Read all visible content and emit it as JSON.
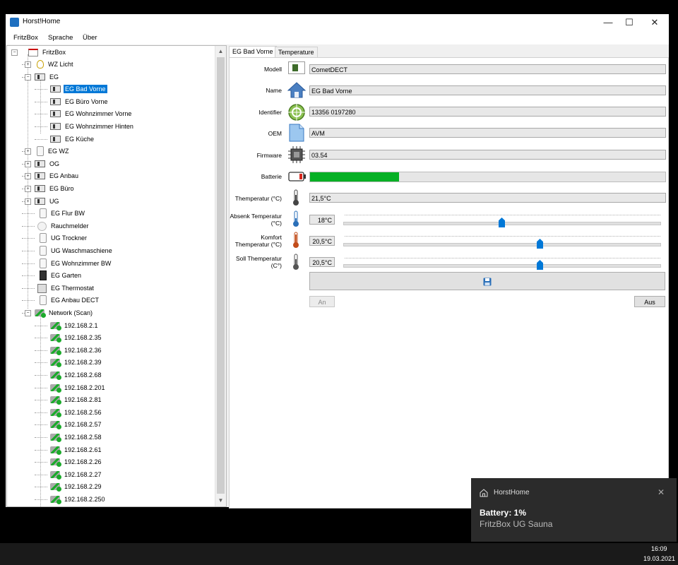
{
  "window": {
    "title": "Horst!Home",
    "controls": [
      "—",
      "☐",
      "✕"
    ]
  },
  "menu": [
    "FritzBox",
    "Sprache",
    "Über"
  ],
  "tree": {
    "root": "FritzBox",
    "items": [
      {
        "label": "WZ Licht",
        "icon": "bulb-icon",
        "level": 1,
        "expander": "+"
      },
      {
        "label": "EG",
        "icon": "switch-icon",
        "level": 1,
        "expander": "−"
      },
      {
        "label": "EG Bad Vorne",
        "icon": "switch-icon",
        "level": 2,
        "selected": true
      },
      {
        "label": "EG Büro Vorne",
        "icon": "switch-icon",
        "level": 2
      },
      {
        "label": "EG Wohnzimmer Vorne",
        "icon": "switch-icon",
        "level": 2
      },
      {
        "label": "EG Wohnzimmer Hinten",
        "icon": "switch-icon",
        "level": 2
      },
      {
        "label": "EG Küche",
        "icon": "switch-icon",
        "level": 2
      },
      {
        "label": "EG WZ",
        "icon": "plug-icon",
        "level": 1,
        "expander": "+"
      },
      {
        "label": "OG",
        "icon": "switch-icon",
        "level": 1,
        "expander": "+"
      },
      {
        "label": "EG Anbau",
        "icon": "switch-icon",
        "level": 1,
        "expander": "+"
      },
      {
        "label": "EG Büro",
        "icon": "switch-icon",
        "level": 1,
        "expander": "+"
      },
      {
        "label": "UG",
        "icon": "switch-icon",
        "level": 1,
        "expander": "+"
      },
      {
        "label": "EG Flur BW",
        "icon": "plug-icon",
        "level": 1
      },
      {
        "label": "Rauchmelder",
        "icon": "smoke-detector-icon",
        "level": 1
      },
      {
        "label": "UG Trockner",
        "icon": "plug-icon",
        "level": 1
      },
      {
        "label": "UG Waschmaschiene",
        "icon": "plug-icon",
        "level": 1
      },
      {
        "label": "EG Wohnzimmer BW",
        "icon": "plug-icon",
        "level": 1
      },
      {
        "label": "EG Garten",
        "icon": "phone-icon",
        "level": 1
      },
      {
        "label": "EG Thermostat",
        "icon": "thermostat-icon",
        "level": 1
      },
      {
        "label": "EG Anbau DECT",
        "icon": "plug-icon",
        "level": 1
      },
      {
        "label": "Network (Scan)",
        "icon": "network-icon",
        "level": 1,
        "expander": "−"
      },
      {
        "label": "192.168.2.1",
        "icon": "network-icon",
        "level": 2
      },
      {
        "label": "192.168.2.35",
        "icon": "network-icon",
        "level": 2
      },
      {
        "label": "192.168.2.36",
        "icon": "network-icon",
        "level": 2
      },
      {
        "label": "192.168.2.39",
        "icon": "network-icon",
        "level": 2
      },
      {
        "label": "192.168.2.68",
        "icon": "network-icon",
        "level": 2
      },
      {
        "label": "192.168.2.201",
        "icon": "network-icon",
        "level": 2
      },
      {
        "label": "192.168.2.81",
        "icon": "network-icon",
        "level": 2
      },
      {
        "label": "192.168.2.56",
        "icon": "network-icon",
        "level": 2
      },
      {
        "label": "192.168.2.57",
        "icon": "network-icon",
        "level": 2
      },
      {
        "label": "192.168.2.58",
        "icon": "network-icon",
        "level": 2
      },
      {
        "label": "192.168.2.61",
        "icon": "network-icon",
        "level": 2
      },
      {
        "label": "192.168.2.26",
        "icon": "network-icon",
        "level": 2
      },
      {
        "label": "192.168.2.27",
        "icon": "network-icon",
        "level": 2
      },
      {
        "label": "192.168.2.29",
        "icon": "network-icon",
        "level": 2
      },
      {
        "label": "192.168.2.250",
        "icon": "network-icon",
        "level": 2
      }
    ]
  },
  "tabs": [
    "EG Bad Vorne",
    "Temperature"
  ],
  "details": {
    "modell_label": "Modell",
    "modell_value": "CometDECT",
    "name_label": "Name",
    "name_value": "EG Bad Vorne",
    "identifier_label": "Identifier",
    "identifier_value": "13356 0197280",
    "oem_label": "OEM",
    "oem_value": "AVM",
    "firmware_label": "Firmware",
    "firmware_value": "03.54",
    "battery_label": "Batterie",
    "battery_level_percent": 25,
    "temperature_label": "Themperatur (°C)",
    "temperature_value": "21,5°C",
    "absenk_label": "Absenk Temperatur (°C)",
    "absenk_value": "18°C",
    "absenk_slider_fraction": 0.5,
    "komfort_label": "Komfort Themperatur (°C)",
    "komfort_value": "20,5°C",
    "komfort_slider_fraction": 0.62,
    "soll_label": "Soll Themperatur (C°)",
    "soll_value": "20,5°C",
    "soll_slider_fraction": 0.62,
    "on_button": "An",
    "off_button": "Aus"
  },
  "toast": {
    "app": "HorstHome",
    "title": "Battery: 1%",
    "body": "FritzBox UG Sauna"
  },
  "taskbar": {
    "time": "16:09",
    "date": "19.03.2021"
  },
  "colors": {
    "selection": "#0078d7",
    "battery": "#06b025",
    "slider": "#0078d7"
  }
}
